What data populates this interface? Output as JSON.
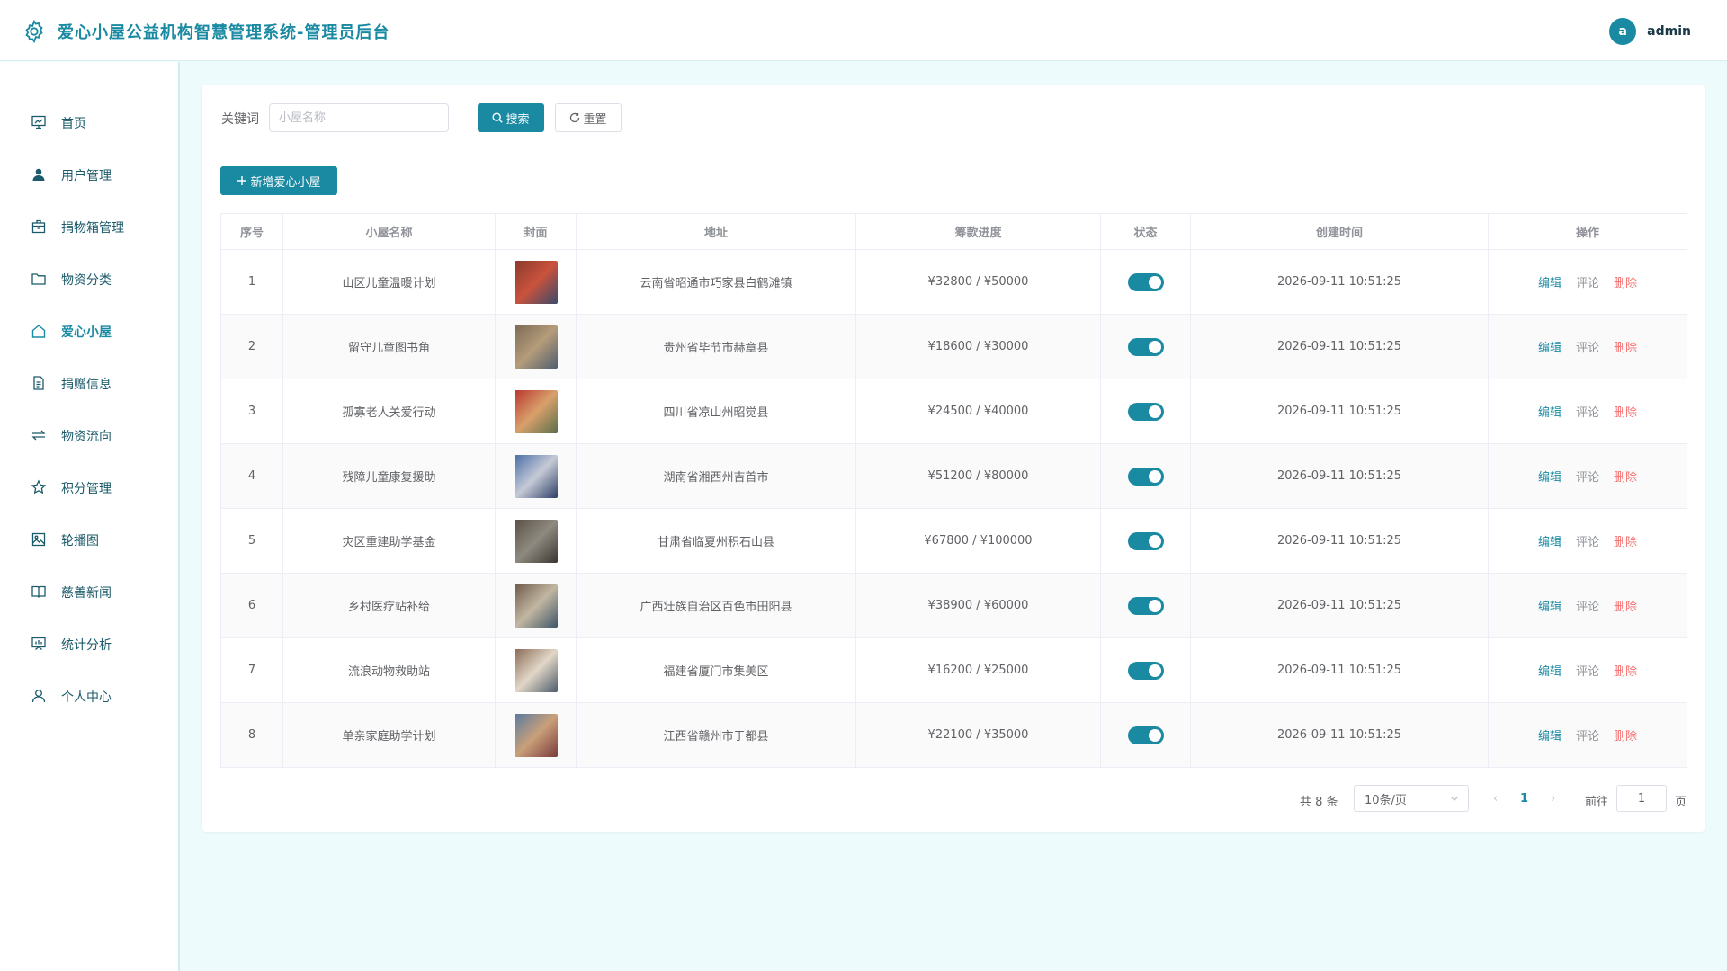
{
  "app": {
    "title": "爱心小屋公益机构智慧管理系统-管理员后台",
    "user_initial": "a",
    "username": "admin"
  },
  "sidebar": {
    "items": [
      {
        "label": "首页",
        "icon": "presentation-chart-icon"
      },
      {
        "label": "用户管理",
        "icon": "user-icon"
      },
      {
        "label": "捐物箱管理",
        "icon": "box-icon"
      },
      {
        "label": "物资分类",
        "icon": "folder-icon"
      },
      {
        "label": "爱心小屋",
        "icon": "house-icon",
        "active": true
      },
      {
        "label": "捐赠信息",
        "icon": "document-icon"
      },
      {
        "label": "物资流向",
        "icon": "switch-arrows-icon"
      },
      {
        "label": "积分管理",
        "icon": "star-icon"
      },
      {
        "label": "轮播图",
        "icon": "picture-icon"
      },
      {
        "label": "慈善新闻",
        "icon": "book-icon"
      },
      {
        "label": "统计分析",
        "icon": "data-board-icon"
      },
      {
        "label": "个人中心",
        "icon": "user-outline-icon"
      }
    ]
  },
  "search": {
    "label": "关键词",
    "placeholder": "小屋名称",
    "value": "",
    "search_button": "搜索",
    "reset_button": "重置"
  },
  "toolbar": {
    "add_button": "新增爱心小屋"
  },
  "table": {
    "columns": [
      "序号",
      "小屋名称",
      "封面",
      "地址",
      "筹款进度",
      "状态",
      "创建时间",
      "操作"
    ],
    "rows": [
      {
        "no": "1",
        "name": "山区儿童温暖计划",
        "address": "云南省昭通市巧家县白鹤滩镇",
        "progress": "¥32800 / ¥50000",
        "enabled": true,
        "created": "2026-09-11 10:51:25"
      },
      {
        "no": "2",
        "name": "留守儿童图书角",
        "address": "贵州省毕节市赫章县",
        "progress": "¥18600 / ¥30000",
        "enabled": true,
        "created": "2026-09-11 10:51:25"
      },
      {
        "no": "3",
        "name": "孤寡老人关爱行动",
        "address": "四川省凉山州昭觉县",
        "progress": "¥24500 / ¥40000",
        "enabled": true,
        "created": "2026-09-11 10:51:25"
      },
      {
        "no": "4",
        "name": "残障儿童康复援助",
        "address": "湖南省湘西州吉首市",
        "progress": "¥51200 / ¥80000",
        "enabled": true,
        "created": "2026-09-11 10:51:25"
      },
      {
        "no": "5",
        "name": "灾区重建助学基金",
        "address": "甘肃省临夏州积石山县",
        "progress": "¥67800 / ¥100000",
        "enabled": true,
        "created": "2026-09-11 10:51:25"
      },
      {
        "no": "6",
        "name": "乡村医疗站补给",
        "address": "广西壮族自治区百色市田阳县",
        "progress": "¥38900 / ¥60000",
        "enabled": true,
        "created": "2026-09-11 10:51:25"
      },
      {
        "no": "7",
        "name": "流浪动物救助站",
        "address": "福建省厦门市集美区",
        "progress": "¥16200 / ¥25000",
        "enabled": true,
        "created": "2026-09-11 10:51:25"
      },
      {
        "no": "8",
        "name": "单亲家庭助学计划",
        "address": "江西省赣州市于都县",
        "progress": "¥22100 / ¥35000",
        "enabled": true,
        "created": "2026-09-11 10:51:25"
      }
    ],
    "actions": {
      "edit": "编辑",
      "comment": "评论",
      "delete": "删除"
    }
  },
  "pagination": {
    "total": "共 8 条",
    "page_size": "10条/页",
    "prev": "‹",
    "current": "1",
    "next": "›",
    "goto_label": "前往",
    "goto_value": "1",
    "page_suffix": "页"
  },
  "colors": {
    "accent": "#1a8aa3",
    "danger": "#f56c6c",
    "background": "#eefbfd"
  }
}
